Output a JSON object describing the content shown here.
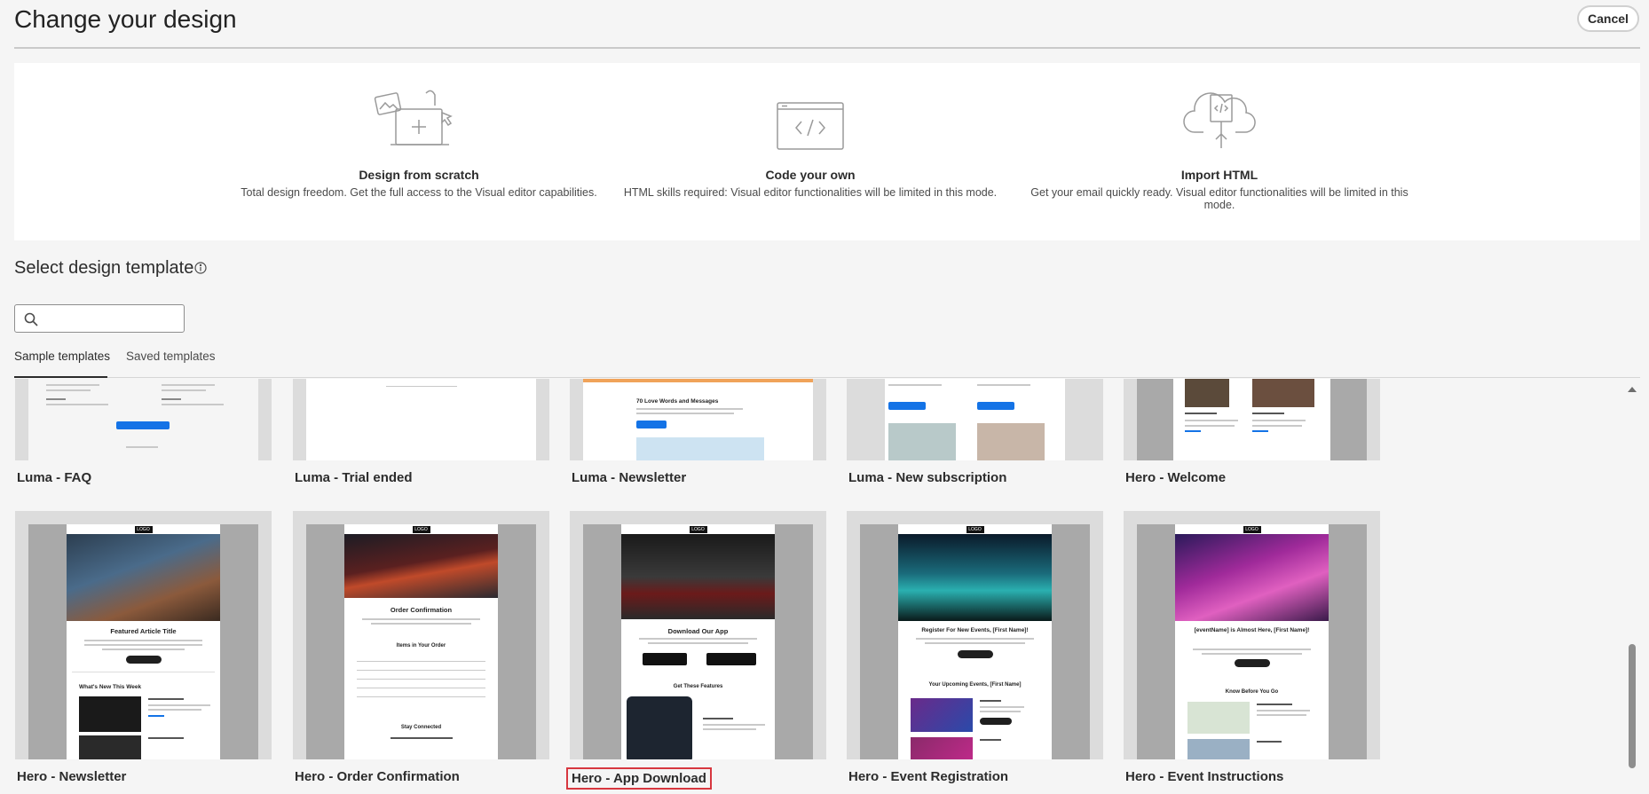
{
  "header": {
    "title": "Change your design",
    "cancel_label": "Cancel"
  },
  "design_options": [
    {
      "title": "Design from scratch",
      "description": "Total design freedom. Get the full access to the Visual editor capabilities.",
      "icon": "design-canvas-icon"
    },
    {
      "title": "Code your own",
      "description": "HTML skills required: Visual editor functionalities will be limited in this mode.",
      "icon": "code-window-icon"
    },
    {
      "title": "Import HTML",
      "description": "Get your email quickly ready. Visual editor functionalities will be limited in this mode.",
      "icon": "cloud-upload-code-icon"
    }
  ],
  "templates_section": {
    "title": "Select design template",
    "search_placeholder": ""
  },
  "tabs": [
    {
      "label": "Sample templates",
      "active": true
    },
    {
      "label": "Saved templates",
      "active": false
    }
  ],
  "templates_row1": [
    {
      "label": "Luma - FAQ"
    },
    {
      "label": "Luma - Trial ended"
    },
    {
      "label": "Luma - Newsletter"
    },
    {
      "label": "Luma - New subscription"
    },
    {
      "label": "Hero - Welcome"
    }
  ],
  "templates_row2": [
    {
      "label": "Hero - Newsletter",
      "selected": false
    },
    {
      "label": "Hero - Order Confirmation",
      "selected": false
    },
    {
      "label": "Hero - App Download",
      "selected": true
    },
    {
      "label": "Hero - Event Registration",
      "selected": false
    },
    {
      "label": "Hero - Event Instructions",
      "selected": false
    }
  ],
  "thumb_text": {
    "logo": "LOGO",
    "get_support": "Get Support",
    "newsletter_heading": "70 Love Words and Messages",
    "read_more": "Read more",
    "featured_title": "Featured Article Title",
    "whats_new": "What's New This Week",
    "order_title": "Order Confirmation",
    "items_in_order": "Items in Your Order",
    "stay_connected": "Stay Connected",
    "download_app": "Download Our App",
    "get_features": "Get These Features",
    "register_title": "Register For New Events, [First Name]!",
    "upcoming_events": "Your Upcoming Events, [First Name]",
    "almost_here": "[eventName] is Almost Here, [First Name]!",
    "know_before": "Know Before You Go"
  },
  "colors": {
    "accent": "#1473e6",
    "selection": "#d7373f",
    "text": "#2c2c2c"
  }
}
